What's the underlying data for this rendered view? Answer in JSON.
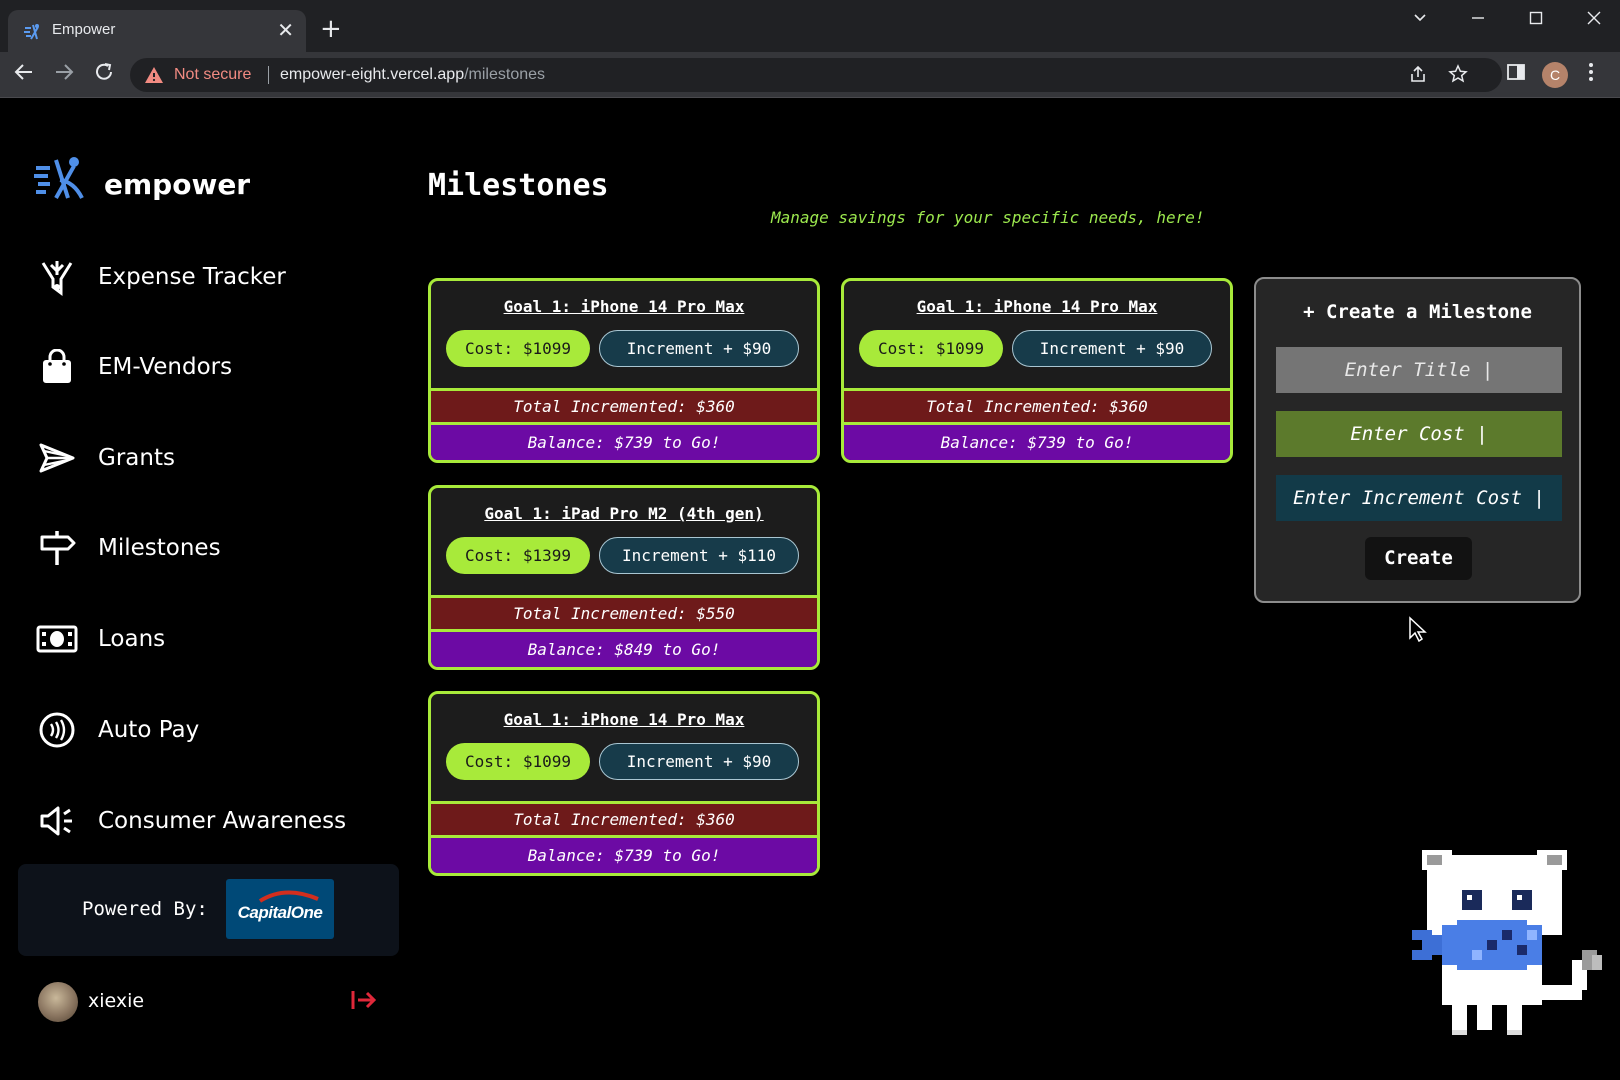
{
  "browser": {
    "tab_title": "Empower",
    "tab_close": "✕",
    "new_tab": "+",
    "security_label": "Not secure",
    "url_host": "empower-eight.vercel.app",
    "url_path": "/milestones",
    "profile_initial": "C"
  },
  "sidebar": {
    "brand": "empower",
    "items": [
      {
        "label": "Expense Tracker",
        "icon": "funnel-icon"
      },
      {
        "label": "EM-Vendors",
        "icon": "shopping-bag-icon"
      },
      {
        "label": "Grants",
        "icon": "paper-plane-icon"
      },
      {
        "label": "Milestones",
        "icon": "signpost-icon"
      },
      {
        "label": "Loans",
        "icon": "cash-icon"
      },
      {
        "label": "Auto Pay",
        "icon": "contactless-icon"
      },
      {
        "label": "Consumer Awareness",
        "icon": "megaphone-icon"
      }
    ],
    "powered_by": "Powered By:",
    "powered_logo_text": "CapitalOne",
    "user": {
      "name": "xiexie"
    }
  },
  "main": {
    "title": "Milestones",
    "subtitle": "Manage savings for your specific needs, here!",
    "goals": [
      {
        "title": "Goal 1: iPhone 14 Pro Max",
        "cost": "Cost: $1099",
        "increment": "Increment + $90",
        "total": "Total Incremented: $360",
        "balance": "Balance: $739 to Go!"
      },
      {
        "title": "Goal 1: iPhone 14 Pro Max",
        "cost": "Cost: $1099",
        "increment": "Increment + $90",
        "total": "Total Incremented: $360",
        "balance": "Balance: $739 to Go!"
      },
      {
        "title": "Goal 1: iPad Pro M2 (4th gen)",
        "cost": "Cost: $1399",
        "increment": "Increment + $110",
        "total": "Total Incremented: $550",
        "balance": "Balance: $849 to Go!"
      },
      {
        "title": "Goal 1: iPhone 14 Pro Max",
        "cost": "Cost: $1099",
        "increment": "Increment + $90",
        "total": "Total Incremented: $360",
        "balance": "Balance: $739 to Go!"
      }
    ],
    "create": {
      "title": "+ Create a Milestone",
      "title_placeholder": "Enter Title |",
      "cost_placeholder": "Enter Cost |",
      "increment_placeholder": "Enter Increment Cost |",
      "button": "Create"
    }
  },
  "colors": {
    "accent_green": "#a8ea3a",
    "total_bar": "#6e1a1a",
    "balance_bar": "#6c0aa4",
    "increment_pill": "#173b4a"
  }
}
